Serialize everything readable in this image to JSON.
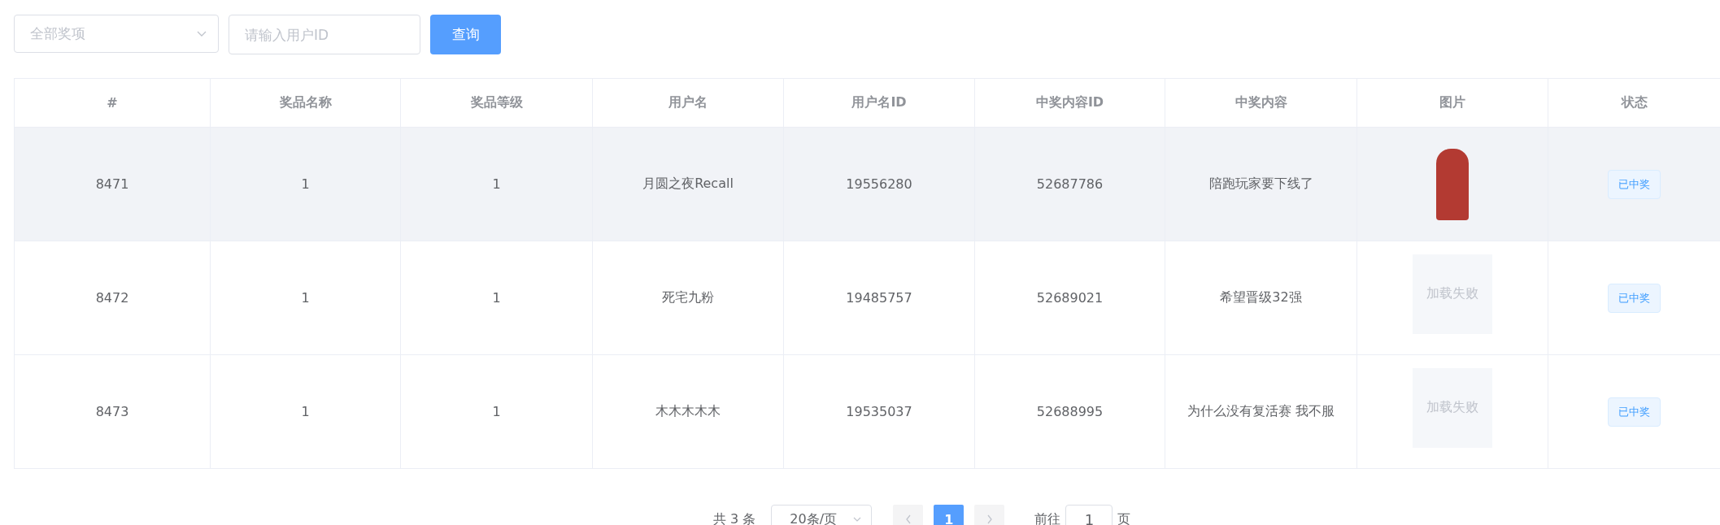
{
  "filters": {
    "prize_select": {
      "placeholder": "全部奖项"
    },
    "user_id_field": {
      "placeholder": "请输入用户ID"
    },
    "query_button": "查询"
  },
  "table": {
    "columns": [
      "#",
      "奖品名称",
      "奖品等级",
      "用户名",
      "用户名ID",
      "中奖内容ID",
      "中奖内容",
      "图片",
      "状态"
    ],
    "rows": [
      {
        "highlighted": true,
        "cells": [
          "8471",
          "1",
          "1",
          "月圆之夜Recall",
          "19556280",
          "52687786",
          "陪跑玩家要下线了"
        ],
        "image": {
          "kind": "loaded"
        },
        "status": "已中奖"
      },
      {
        "highlighted": false,
        "cells": [
          "8472",
          "1",
          "1",
          "死宅九粉",
          "19485757",
          "52689021",
          "希望晋级32强"
        ],
        "image": {
          "kind": "failed",
          "text": "加载失败"
        },
        "status": "已中奖"
      },
      {
        "highlighted": false,
        "cells": [
          "8473",
          "1",
          "1",
          "木木木木木",
          "19535037",
          "52688995",
          "为什么没有复活赛 我不服"
        ],
        "image": {
          "kind": "failed",
          "text": "加载失败"
        },
        "status": "已中奖"
      }
    ]
  },
  "pagination": {
    "total": "共 3 条",
    "page_size": "20条/页",
    "pages": [
      {
        "label": "1",
        "selected": true
      }
    ],
    "goto_label": "前往",
    "goto_value": "1",
    "goto_suffix": "页"
  }
}
